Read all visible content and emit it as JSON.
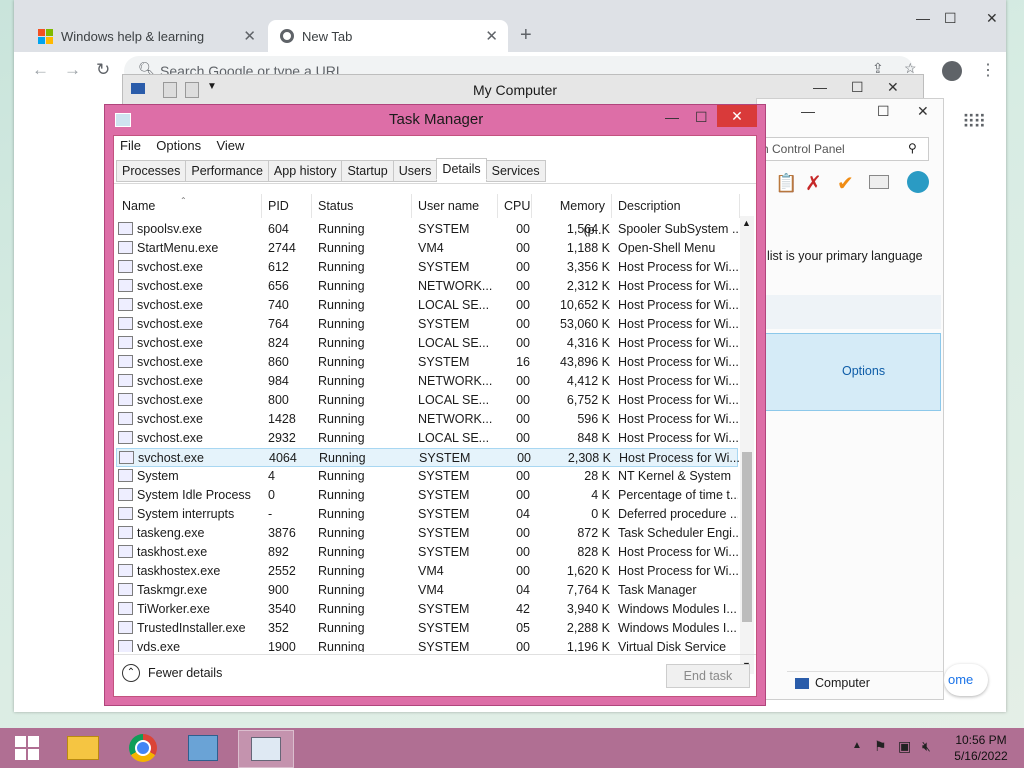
{
  "chrome": {
    "tabs": [
      {
        "title": "Windows help & learning",
        "icon": "windows-logo-icon"
      },
      {
        "title": "New Tab",
        "icon": "chrome-icon"
      }
    ],
    "omnibox_placeholder": "Search Google or type a URL",
    "promo_text": "ome"
  },
  "my_computer": {
    "title": "My Computer"
  },
  "control_panel": {
    "search_placeholder": "h Control Panel",
    "language_text": "list is your primary language",
    "options_label": "Options",
    "status_item": "Computer"
  },
  "task_manager": {
    "title": "Task Manager",
    "menu": [
      "File",
      "Options",
      "View"
    ],
    "tabs": [
      "Processes",
      "Performance",
      "App history",
      "Startup",
      "Users",
      "Details",
      "Services"
    ],
    "active_tab": "Details",
    "columns": [
      "Name",
      "PID",
      "Status",
      "User name",
      "CPU",
      "Memory (p...",
      "Description"
    ],
    "rows": [
      [
        "spoolsv.exe",
        "604",
        "Running",
        "SYSTEM",
        "00",
        "1,564 K",
        "Spooler SubSystem ..."
      ],
      [
        "StartMenu.exe",
        "2744",
        "Running",
        "VM4",
        "00",
        "1,188 K",
        "Open-Shell Menu"
      ],
      [
        "svchost.exe",
        "612",
        "Running",
        "SYSTEM",
        "00",
        "3,356 K",
        "Host Process for Wi..."
      ],
      [
        "svchost.exe",
        "656",
        "Running",
        "NETWORK...",
        "00",
        "2,312 K",
        "Host Process for Wi..."
      ],
      [
        "svchost.exe",
        "740",
        "Running",
        "LOCAL SE...",
        "00",
        "10,652 K",
        "Host Process for Wi..."
      ],
      [
        "svchost.exe",
        "764",
        "Running",
        "SYSTEM",
        "00",
        "53,060 K",
        "Host Process for Wi..."
      ],
      [
        "svchost.exe",
        "824",
        "Running",
        "LOCAL SE...",
        "00",
        "4,316 K",
        "Host Process for Wi..."
      ],
      [
        "svchost.exe",
        "860",
        "Running",
        "SYSTEM",
        "16",
        "43,896 K",
        "Host Process for Wi..."
      ],
      [
        "svchost.exe",
        "984",
        "Running",
        "NETWORK...",
        "00",
        "4,412 K",
        "Host Process for Wi..."
      ],
      [
        "svchost.exe",
        "800",
        "Running",
        "LOCAL SE...",
        "00",
        "6,752 K",
        "Host Process for Wi..."
      ],
      [
        "svchost.exe",
        "1428",
        "Running",
        "NETWORK...",
        "00",
        "596 K",
        "Host Process for Wi..."
      ],
      [
        "svchost.exe",
        "2932",
        "Running",
        "LOCAL SE...",
        "00",
        "848 K",
        "Host Process for Wi..."
      ],
      [
        "svchost.exe",
        "4064",
        "Running",
        "SYSTEM",
        "00",
        "2,308 K",
        "Host Process for Wi..."
      ],
      [
        "System",
        "4",
        "Running",
        "SYSTEM",
        "00",
        "28 K",
        "NT Kernel & System"
      ],
      [
        "System Idle Process",
        "0",
        "Running",
        "SYSTEM",
        "00",
        "4 K",
        "Percentage of time t..."
      ],
      [
        "System interrupts",
        "-",
        "Running",
        "SYSTEM",
        "04",
        "0 K",
        "Deferred procedure ..."
      ],
      [
        "taskeng.exe",
        "3876",
        "Running",
        "SYSTEM",
        "00",
        "872 K",
        "Task Scheduler Engi..."
      ],
      [
        "taskhost.exe",
        "892",
        "Running",
        "SYSTEM",
        "00",
        "828 K",
        "Host Process for Wi..."
      ],
      [
        "taskhostex.exe",
        "2552",
        "Running",
        "VM4",
        "00",
        "1,620 K",
        "Host Process for Wi..."
      ],
      [
        "Taskmgr.exe",
        "900",
        "Running",
        "VM4",
        "04",
        "7,764 K",
        "Task Manager"
      ],
      [
        "TiWorker.exe",
        "3540",
        "Running",
        "SYSTEM",
        "42",
        "3,940 K",
        "Windows Modules I..."
      ],
      [
        "TrustedInstaller.exe",
        "352",
        "Running",
        "SYSTEM",
        "05",
        "2,288 K",
        "Windows Modules I..."
      ],
      [
        "vds.exe",
        "1900",
        "Running",
        "SYSTEM",
        "00",
        "1,196 K",
        "Virtual Disk Service"
      ]
    ],
    "selected_index": 12,
    "fewer_details": "Fewer details",
    "end_task": "End task"
  },
  "taskbar": {
    "time": "10:56 PM",
    "date": "5/16/2022"
  },
  "colors": {
    "accent": "#dd6ea7",
    "taskbar": "#b06f93",
    "selection": "#e5f3fb"
  }
}
